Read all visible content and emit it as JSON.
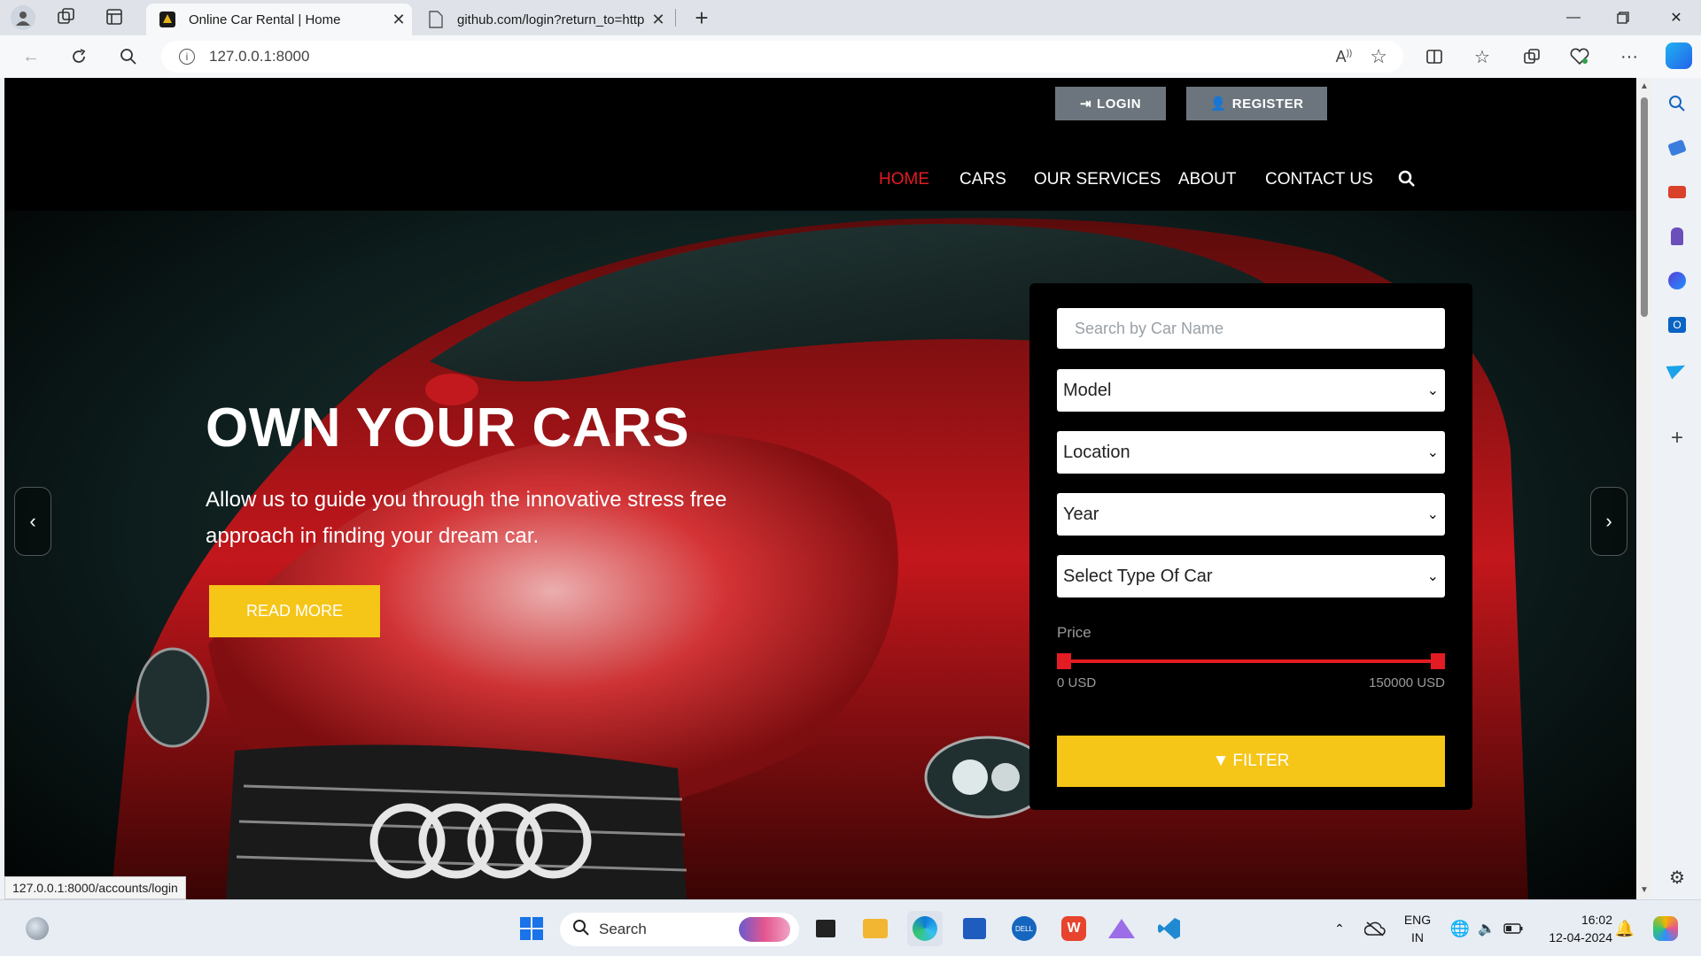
{
  "browser": {
    "tabs": [
      {
        "title": "Online Car Rental | Home",
        "active": true
      },
      {
        "title": "github.com/login?return_to=http",
        "active": false
      }
    ],
    "url": "127.0.0.1:8000",
    "status_url": "127.0.0.1:8000/accounts/login"
  },
  "site": {
    "top_buttons": {
      "login": "LOGIN",
      "register": "REGISTER"
    },
    "menu": [
      {
        "label": "HOME",
        "active": true
      },
      {
        "label": "CARS",
        "active": false
      },
      {
        "label": "OUR SERVICES",
        "active": false
      },
      {
        "label": "ABOUT",
        "active": false
      },
      {
        "label": "CONTACT US",
        "active": false
      }
    ],
    "hero": {
      "title": "OWN YOUR CARS",
      "text": "Allow us to guide you through the innovative stress free approach in finding your dream car.",
      "button": "READ MORE"
    },
    "filter": {
      "search_placeholder": "Search by Car Name",
      "selects": [
        "Model",
        "Location",
        "Year",
        "Select Type Of Car"
      ],
      "price_label": "Price",
      "price_min": "0 USD",
      "price_max": "150000 USD",
      "button": "FILTER"
    },
    "colors": {
      "accent_yellow": "#f5c518",
      "accent_red": "#e31b23",
      "active_menu": "#e31b23"
    }
  },
  "taskbar": {
    "search_label": "Search",
    "lang": "ENG",
    "region": "IN",
    "time": "16:02",
    "date": "12-04-2024"
  }
}
